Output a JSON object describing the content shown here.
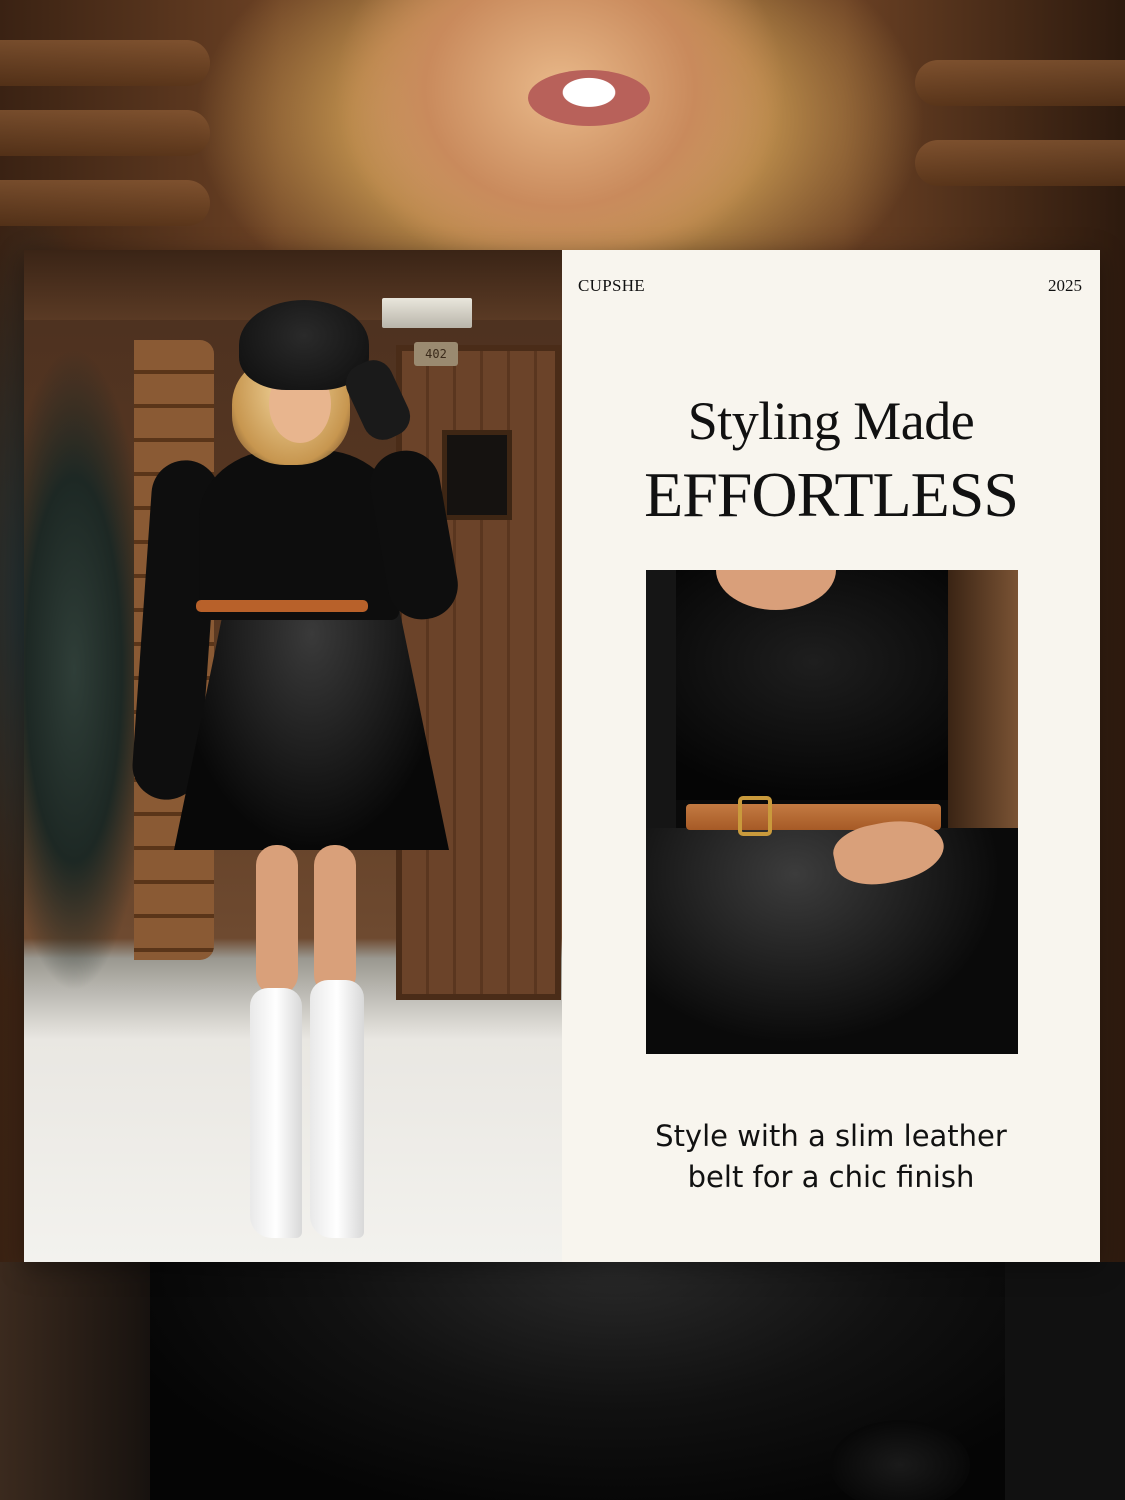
{
  "panel": {
    "brand": "CUPSHE",
    "year": "2025",
    "headline_line1": "Styling Made",
    "headline_line2": "EFFORTLESS",
    "caption_line1": "Style with a slim leather",
    "caption_line2": "belt for a chic finish"
  },
  "photo": {
    "door_number": "402"
  },
  "colors": {
    "panel_background": "#f8f5ee",
    "text": "#111111",
    "belt": "#b8612a"
  }
}
